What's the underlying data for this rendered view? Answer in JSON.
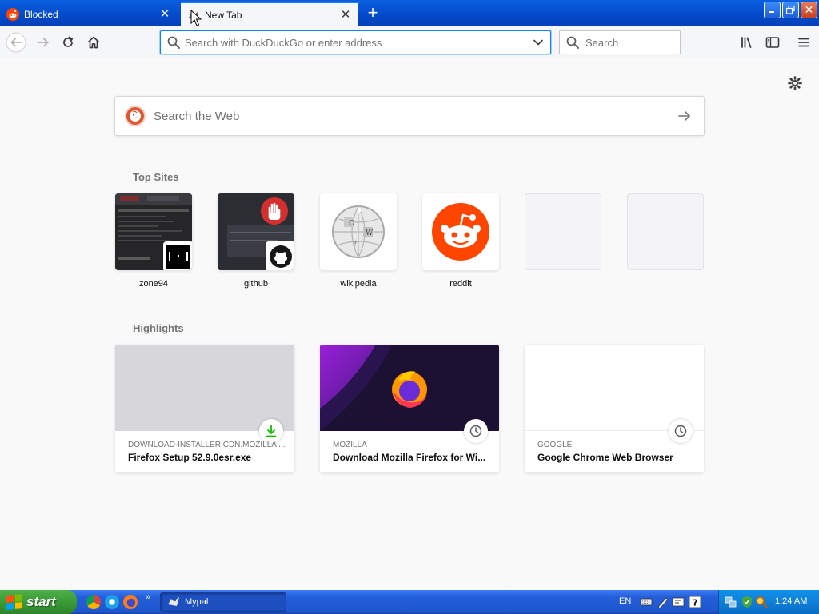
{
  "browser": {
    "tabs": [
      {
        "title": "Blocked",
        "active": false,
        "favicon": "reddit-icon"
      },
      {
        "title": "New Tab",
        "active": true,
        "favicon": "mypal-icon"
      }
    ],
    "new_tab_label": "+",
    "close_glyph": "✕",
    "toolbar": {
      "urlbar_placeholder": "Search with DuckDuckGo or enter address",
      "searchbar_placeholder": "Search"
    },
    "window_controls": {
      "minimize": "_",
      "maximize": "▫",
      "close": "✕"
    }
  },
  "newtab": {
    "search_placeholder": "Search the Web",
    "search_engine_icon": "duckduckgo-icon",
    "top_sites_title": "Top Sites",
    "top_sites": [
      {
        "label": "zone94",
        "badge": "pong-icon"
      },
      {
        "label": "github",
        "badge": "github-icon"
      },
      {
        "label": "wikipedia",
        "badge": "wikipedia-globe-icon"
      },
      {
        "label": "reddit",
        "badge": "reddit-icon"
      },
      {
        "label": "",
        "badge": ""
      },
      {
        "label": "",
        "badge": ""
      }
    ],
    "highlights_title": "Highlights",
    "highlights": [
      {
        "host": "DOWNLOAD-INSTALLER.CDN.MOZILLA ...",
        "title": "Firefox Setup 52.9.0esr.exe",
        "type_icon": "download-icon",
        "accent": "#12bc00"
      },
      {
        "host": "MOZILLA",
        "title": "Download Mozilla Firefox for Wi...",
        "type_icon": "history-clock-icon"
      },
      {
        "host": "GOOGLE",
        "title": "Google Chrome Web Browser",
        "type_icon": "history-clock-icon"
      }
    ]
  },
  "taskbar": {
    "start_label": "start",
    "task_label": "Mypal",
    "language": "EN",
    "time": "1:24 AM",
    "more_glyph": "»"
  },
  "colors": {
    "accent": "#0a84ff",
    "titlebar": "#0449c9",
    "reddit": "#ff4500",
    "duckduckgo": "#de5833"
  }
}
